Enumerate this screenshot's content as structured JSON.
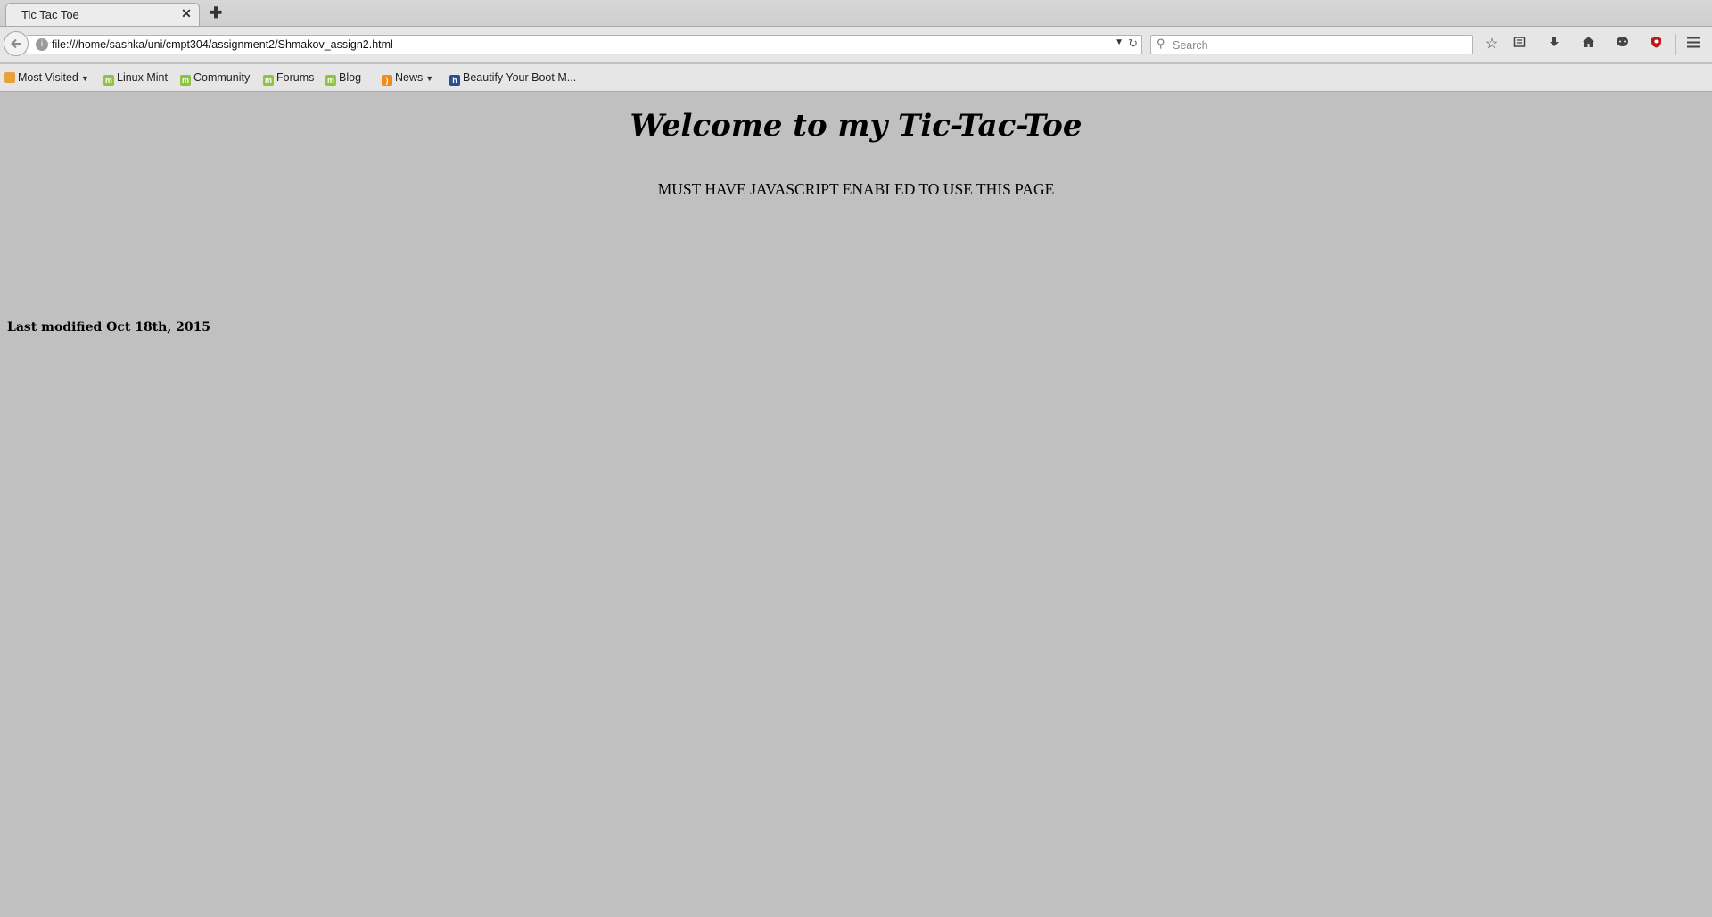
{
  "browser": {
    "tab": {
      "title": "Tic Tac Toe",
      "close_glyph": "✕"
    },
    "new_tab_glyph": "✚",
    "url": "file:///home/sashka/uni/cmpt304/assignment2/Shmakov_assign2.html",
    "search": {
      "placeholder": "Search",
      "value": ""
    },
    "toolbar_icons": [
      "star-icon",
      "reading-list-icon",
      "download-icon",
      "home-icon",
      "chat-icon",
      "shield-icon",
      "menu-icon"
    ]
  },
  "bookmarks": [
    {
      "label": "Most Visited",
      "icon": "folder-icon",
      "has_dropdown": true
    },
    {
      "label": "Linux Mint",
      "icon": "mint-icon",
      "has_dropdown": false
    },
    {
      "label": "Community",
      "icon": "mint-icon",
      "has_dropdown": false
    },
    {
      "label": "Forums",
      "icon": "mint-icon",
      "has_dropdown": false
    },
    {
      "label": "Blog",
      "icon": "mint-icon",
      "has_dropdown": false
    },
    {
      "label": "News",
      "icon": "rss-icon",
      "has_dropdown": true
    },
    {
      "label": "Beautify Your Boot M...",
      "icon": "h-icon",
      "has_dropdown": false
    }
  ],
  "page": {
    "background_color": "#c0c0c0",
    "heading": "Welcome to my Tic-Tac-Toe",
    "noscript_message": "MUST HAVE JAVASCRIPT ENABLED TO USE THIS PAGE",
    "footer": "Last modified Oct 18th, 2015"
  }
}
